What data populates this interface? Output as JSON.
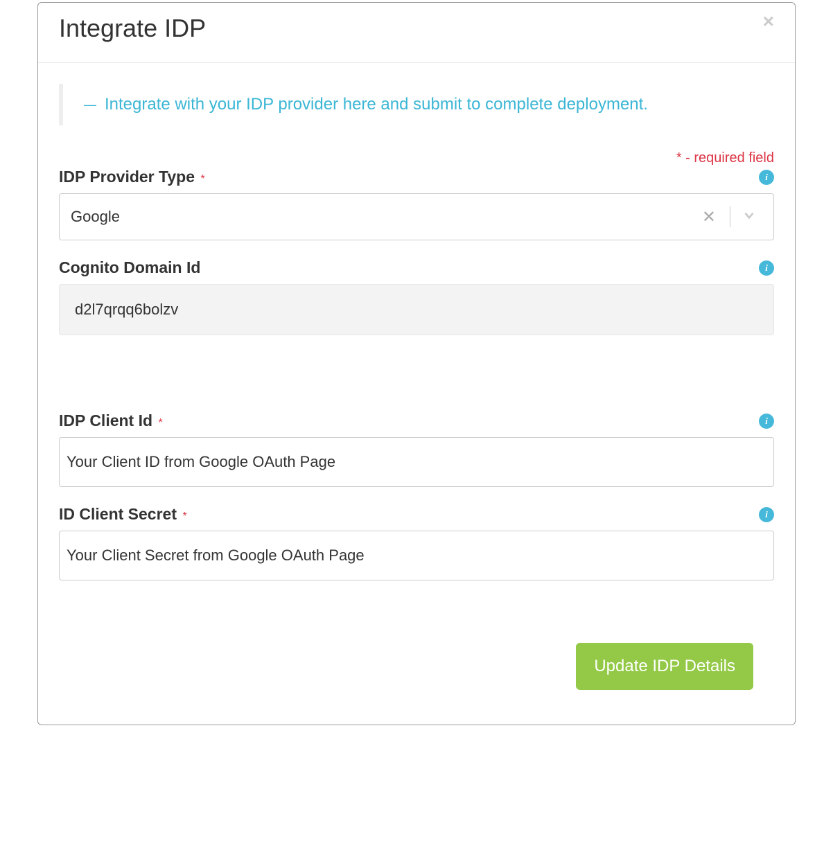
{
  "modal": {
    "title": "Integrate IDP",
    "banner_text": "Integrate with your IDP provider here and submit to complete deployment.",
    "required_note": "* - required field",
    "submit_label": "Update IDP Details"
  },
  "fields": {
    "provider_type": {
      "label": "IDP Provider Type",
      "value": "Google",
      "required": true
    },
    "cognito_domain": {
      "label": "Cognito Domain Id",
      "value": "d2l7qrqq6bolzv",
      "required": false
    },
    "client_id": {
      "label": "IDP Client Id",
      "placeholder": "Your Client ID from Google OAuth Page",
      "required": true
    },
    "client_secret": {
      "label": "ID Client Secret",
      "placeholder": "Your Client Secret from Google OAuth Page",
      "required": true
    }
  },
  "symbols": {
    "star": "*",
    "dash": "—"
  }
}
